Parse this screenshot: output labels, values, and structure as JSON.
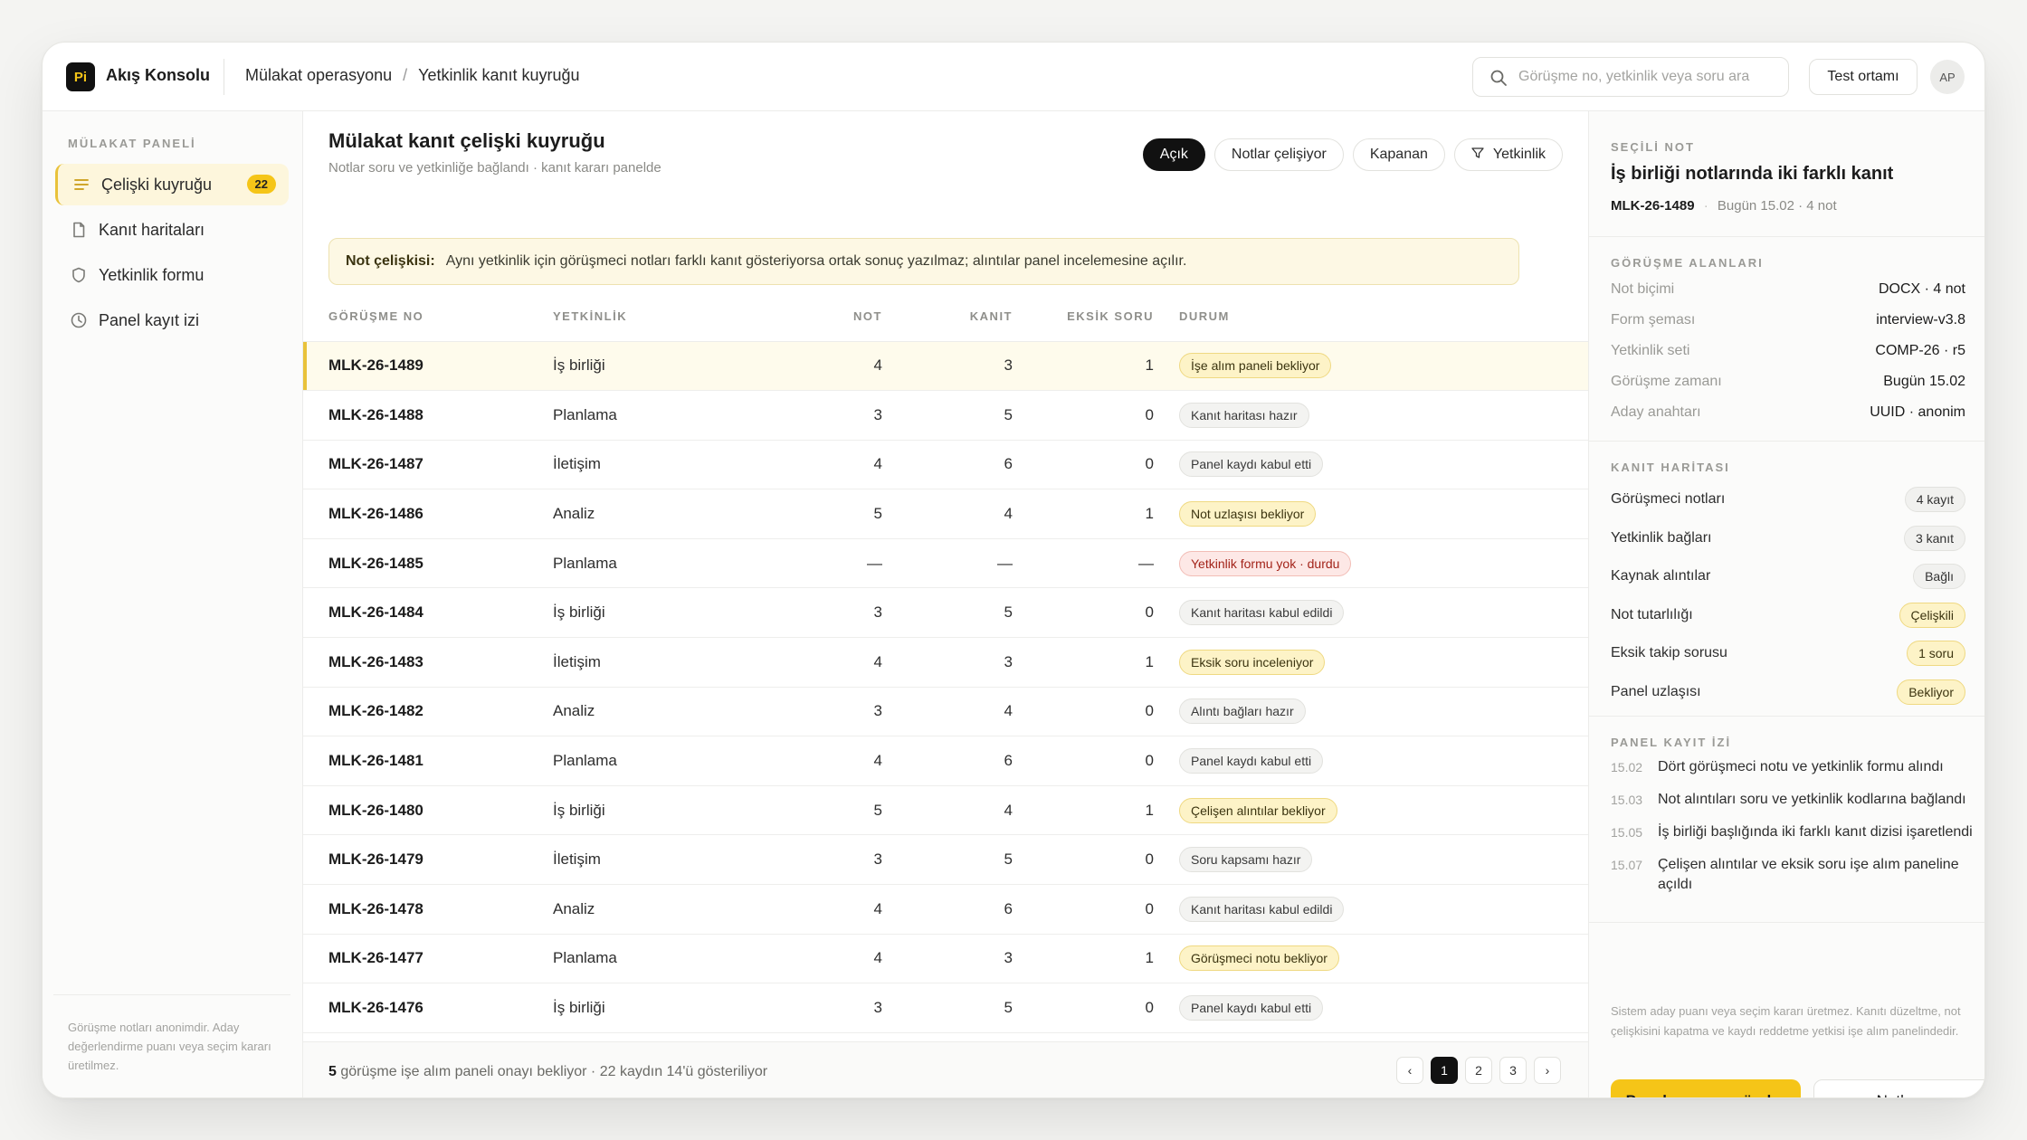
{
  "app": {
    "logo": "Pi",
    "title": "Akış Konsolu"
  },
  "breadcrumb": {
    "parent": "Mülakat operasyonu",
    "separator": "/",
    "current": "Yetkinlik kanıt kuyruğu"
  },
  "search": {
    "placeholder": "Görüşme no, yetkinlik veya soru ara"
  },
  "header": {
    "env_label": "Test ortamı",
    "avatar": "AP"
  },
  "sidebar": {
    "section_title": "MÜLAKAT PANELİ",
    "items": [
      {
        "label": "Çelişki kuyruğu",
        "badge": "22",
        "icon": "list-icon"
      },
      {
        "label": "Kanıt haritaları",
        "icon": "document-icon"
      },
      {
        "label": "Yetkinlik formu",
        "icon": "shield-icon"
      },
      {
        "label": "Panel kayıt izi",
        "icon": "clock-icon"
      }
    ],
    "footer_note": "Görüşme notları anonimdir. Aday değerlendirme puanı veya seçim kararı üretilmez."
  },
  "main": {
    "title": "Mülakat kanıt çelişki kuyruğu",
    "subtitle": "Notlar soru ve yetkinliğe bağlandı · kanıt kararı panelde",
    "filters": [
      "Açık",
      "Notlar çelişiyor",
      "Kapanan"
    ],
    "filter_button": "Yetkinlik",
    "alert": {
      "label": "Not çelişkisi:",
      "text": "Aynı yetkinlik için görüşmeci notları farklı kanıt gösteriyorsa ortak sonuç yazılmaz; alıntılar panel incelemesine açılır."
    },
    "columns": [
      "GÖRÜŞME NO",
      "YETKİNLİK",
      "NOT",
      "KANIT",
      "EKSİK SORU",
      "DURUM"
    ],
    "rows": [
      {
        "id": "MLK-26-1489",
        "comp": "İş birliği",
        "not": "4",
        "kanit": "3",
        "eksik": "1",
        "status": "İşe alım paneli bekliyor",
        "tone": "yellow"
      },
      {
        "id": "MLK-26-1488",
        "comp": "Planlama",
        "not": "3",
        "kanit": "5",
        "eksik": "0",
        "status": "Kanıt haritası hazır",
        "tone": "gray"
      },
      {
        "id": "MLK-26-1487",
        "comp": "İletişim",
        "not": "4",
        "kanit": "6",
        "eksik": "0",
        "status": "Panel kaydı kabul etti",
        "tone": "gray"
      },
      {
        "id": "MLK-26-1486",
        "comp": "Analiz",
        "not": "5",
        "kanit": "4",
        "eksik": "1",
        "status": "Not uzlaşısı bekliyor",
        "tone": "yellow"
      },
      {
        "id": "MLK-26-1485",
        "comp": "Planlama",
        "not": "—",
        "kanit": "—",
        "eksik": "—",
        "status": "Yetkinlik formu yok · durdu",
        "tone": "red"
      },
      {
        "id": "MLK-26-1484",
        "comp": "İş birliği",
        "not": "3",
        "kanit": "5",
        "eksik": "0",
        "status": "Kanıt haritası kabul edildi",
        "tone": "gray"
      },
      {
        "id": "MLK-26-1483",
        "comp": "İletişim",
        "not": "4",
        "kanit": "3",
        "eksik": "1",
        "status": "Eksik soru inceleniyor",
        "tone": "yellow"
      },
      {
        "id": "MLK-26-1482",
        "comp": "Analiz",
        "not": "3",
        "kanit": "4",
        "eksik": "0",
        "status": "Alıntı bağları hazır",
        "tone": "gray"
      },
      {
        "id": "MLK-26-1481",
        "comp": "Planlama",
        "not": "4",
        "kanit": "6",
        "eksik": "0",
        "status": "Panel kaydı kabul etti",
        "tone": "gray"
      },
      {
        "id": "MLK-26-1480",
        "comp": "İş birliği",
        "not": "5",
        "kanit": "4",
        "eksik": "1",
        "status": "Çelişen alıntılar bekliyor",
        "tone": "yellow"
      },
      {
        "id": "MLK-26-1479",
        "comp": "İletişim",
        "not": "3",
        "kanit": "5",
        "eksik": "0",
        "status": "Soru kapsamı hazır",
        "tone": "gray"
      },
      {
        "id": "MLK-26-1478",
        "comp": "Analiz",
        "not": "4",
        "kanit": "6",
        "eksik": "0",
        "status": "Kanıt haritası kabul edildi",
        "tone": "gray"
      },
      {
        "id": "MLK-26-1477",
        "comp": "Planlama",
        "not": "4",
        "kanit": "3",
        "eksik": "1",
        "status": "Görüşmeci notu bekliyor",
        "tone": "yellow"
      },
      {
        "id": "MLK-26-1476",
        "comp": "İş birliği",
        "not": "3",
        "kanit": "5",
        "eksik": "0",
        "status": "Panel kaydı kabul etti",
        "tone": "gray"
      }
    ],
    "footer": {
      "count": "5",
      "text": " görüşme işe alım paneli onayı bekliyor · 22 kaydın 14'ü gösteriliyor"
    },
    "pager": {
      "prev": "‹",
      "pages": [
        "1",
        "2",
        "3"
      ],
      "next": "›"
    }
  },
  "panel": {
    "selected_label": "SEÇİLİ NOT",
    "title": "İş birliği notlarında iki farklı kanıt",
    "meta_id": "MLK-26-1489",
    "meta_rest": "Bugün 15.02 · 4 not",
    "fields_label": "GÖRÜŞME ALANLARI",
    "fields": [
      {
        "k": "Not biçimi",
        "v": "DOCX · 4 not"
      },
      {
        "k": "Form şeması",
        "v": "interview-v3.8"
      },
      {
        "k": "Yetkinlik seti",
        "v": "COMP-26 · r5"
      },
      {
        "k": "Görüşme zamanı",
        "v": "Bugün 15.02"
      },
      {
        "k": "Aday anahtarı",
        "v": "UUID · anonim"
      }
    ],
    "map_label": "KANIT HARİTASI",
    "map": [
      {
        "k": "Görüşmeci notları",
        "v": "4 kayıt",
        "tone": "gray"
      },
      {
        "k": "Yetkinlik bağları",
        "v": "3 kanıt",
        "tone": "gray"
      },
      {
        "k": "Kaynak alıntılar",
        "v": "Bağlı",
        "tone": "gray"
      },
      {
        "k": "Not tutarlılığı",
        "v": "Çelişkili",
        "tone": "yellow"
      },
      {
        "k": "Eksik takip sorusu",
        "v": "1 soru",
        "tone": "yellow"
      },
      {
        "k": "Panel uzlaşısı",
        "v": "Bekliyor",
        "tone": "yellow"
      }
    ],
    "log_label": "PANEL KAYIT İZİ",
    "log": [
      {
        "t": "15.02",
        "text": "Dört görüşmeci notu ve yetkinlik formu alındı"
      },
      {
        "t": "15.03",
        "text": "Not alıntıları soru ve yetkinlik kodlarına bağlandı"
      },
      {
        "t": "15.05",
        "text": "İş birliği başlığında iki farklı kanıt dizisi işaretlendi"
      },
      {
        "t": "15.07",
        "text": "Çelişen alıntılar ve eksik soru işe alım paneline açıldı"
      }
    ],
    "note": "Sistem aday puanı veya seçim kararı üretmez. Kanıtı düzeltme, not çelişkisini kapatma ve kaydı reddetme yetkisi işe alım panelindedir.",
    "primary_button": "Panel onayına gönder",
    "secondary_button": "Notları aç"
  }
}
